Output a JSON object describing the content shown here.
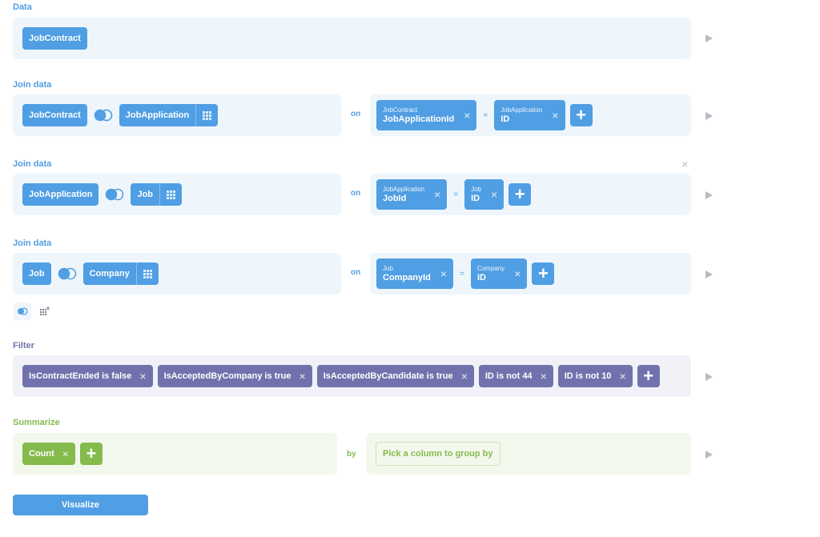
{
  "data_step": {
    "title": "Data",
    "table": "JobContract"
  },
  "joins": [
    {
      "title": "Join data",
      "left_table": "JobContract",
      "right_table": "JobApplication",
      "on_label": "on",
      "left_cond": {
        "table": "JobContract",
        "column": "JobApplicationId"
      },
      "eq": "=",
      "right_cond": {
        "table": "JobApplication",
        "column": "ID"
      }
    },
    {
      "title": "Join data",
      "left_table": "JobApplication",
      "right_table": "Job",
      "on_label": "on",
      "left_cond": {
        "table": "JobApplication",
        "column": "JobId"
      },
      "eq": "=",
      "right_cond": {
        "table": "Job",
        "column": "ID"
      }
    },
    {
      "title": "Join data",
      "left_table": "Job",
      "right_table": "Company",
      "on_label": "on",
      "left_cond": {
        "table": "Job",
        "column": "CompanyId"
      },
      "eq": "=",
      "right_cond": {
        "table": "Company",
        "column": "ID"
      }
    }
  ],
  "filter": {
    "title": "Filter",
    "items": [
      "IsContractEnded is false",
      "IsAcceptedByCompany is true",
      "IsAcceptedByCandidate is true",
      "ID is not 44",
      "ID is not 10"
    ]
  },
  "summarize": {
    "title": "Summarize",
    "metric": "Count",
    "by_label": "by",
    "group_placeholder": "Pick a column to group by"
  },
  "visualize_label": "Visualize",
  "icons": {
    "plus": "+",
    "close": "×"
  },
  "colors": {
    "blue": "#509ee3",
    "purple": "#7172ad",
    "green": "#84bb4c"
  }
}
